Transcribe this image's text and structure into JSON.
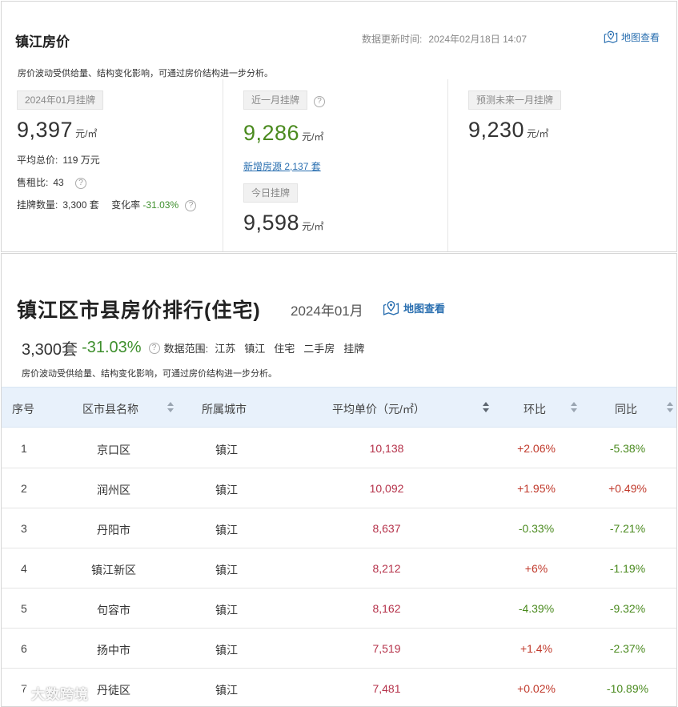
{
  "top": {
    "title": "镇江房价",
    "update_label": "数据更新时间:",
    "update_time": "2024年02月18日 14:07",
    "map_link": "地图查看",
    "description": "房价波动受供给量、结构变化影响，可通过房价结构进一步分析。",
    "listing": {
      "tag": "2024年01月挂牌",
      "price": "9,397",
      "unit": "元/㎡",
      "avg_total_label": "平均总价:",
      "avg_total_value": "119 万元",
      "rent_ratio_label": "售租比:",
      "rent_ratio_value": "43",
      "count_label": "挂牌数量:",
      "count_value": "3,300 套",
      "change_label": "变化率",
      "change_value": "-31.03%"
    },
    "recent": {
      "tag": "近一月挂牌",
      "price": "9,286",
      "unit": "元/㎡",
      "new_listings": "新增房源 2,137 套",
      "today_tag": "今日挂牌",
      "today_price": "9,598",
      "today_unit": "元/㎡"
    },
    "forecast": {
      "tag": "预测未来一月挂牌",
      "price": "9,230",
      "unit": "元/㎡"
    },
    "help_icon": "?"
  },
  "ranking": {
    "title": "镇江区市县房价排行(住宅)",
    "date": "2024年01月",
    "map_link": "地图查看",
    "count": "3,300套",
    "change": "-31.03%",
    "scope_label": "数据范围:",
    "scope": [
      "江苏",
      "镇江",
      "住宅",
      "二手房",
      "挂牌"
    ],
    "description": "房价波动受供给量、结构变化影响，可通过房价结构进一步分析。",
    "columns": [
      "序号",
      "区市县名称",
      "所属城市",
      "平均单价（元/㎡）",
      "环比",
      "同比"
    ],
    "rows": [
      {
        "idx": "1",
        "name": "京口区",
        "city": "镇江",
        "price": "10,138",
        "mom": "+2.06%",
        "yoy": "-5.38%"
      },
      {
        "idx": "2",
        "name": "润州区",
        "city": "镇江",
        "price": "10,092",
        "mom": "+1.95%",
        "yoy": "+0.49%"
      },
      {
        "idx": "3",
        "name": "丹阳市",
        "city": "镇江",
        "price": "8,637",
        "mom": "-0.33%",
        "yoy": "-7.21%"
      },
      {
        "idx": "4",
        "name": "镇江新区",
        "city": "镇江",
        "price": "8,212",
        "mom": "+6%",
        "yoy": "-1.19%"
      },
      {
        "idx": "5",
        "name": "句容市",
        "city": "镇江",
        "price": "8,162",
        "mom": "-4.39%",
        "yoy": "-9.32%"
      },
      {
        "idx": "6",
        "name": "扬中市",
        "city": "镇江",
        "price": "7,519",
        "mom": "+1.4%",
        "yoy": "-2.37%"
      },
      {
        "idx": "7",
        "name": "丹徒区",
        "city": "镇江",
        "price": "7,481",
        "mom": "+0.02%",
        "yoy": "-10.89%"
      }
    ]
  },
  "colors": {
    "link_blue": "#2a6fb0",
    "up_red": "#c0392b",
    "down_green": "#4a8a1e",
    "price_red": "#b5324a",
    "header_bg": "#e8f1fb"
  },
  "icons": [
    "map-pin-icon",
    "help-icon",
    "sort-icon",
    "watermark-logo-icon"
  ],
  "watermark": "大数跨境"
}
